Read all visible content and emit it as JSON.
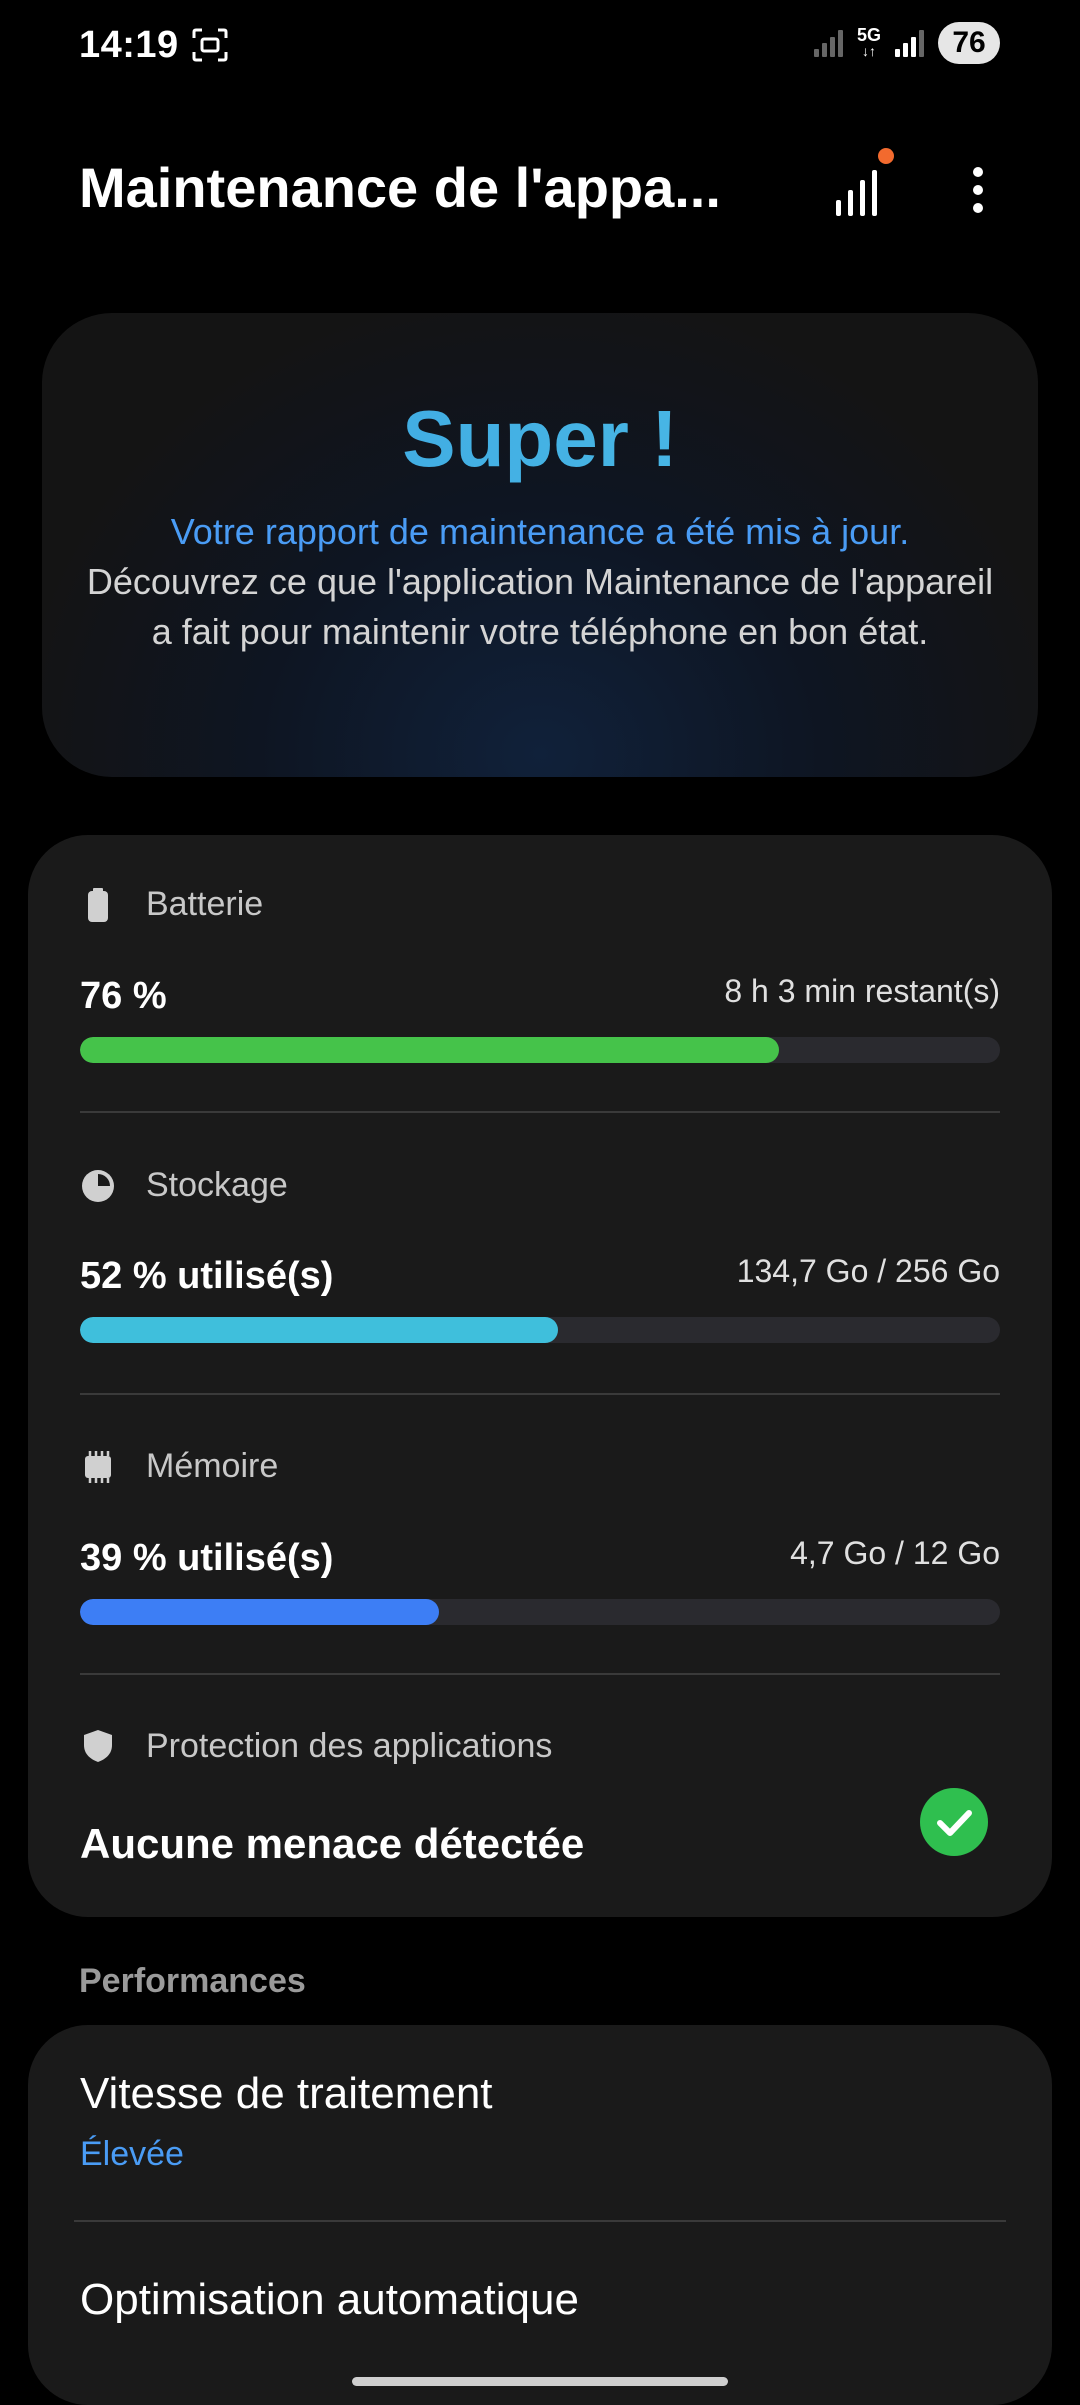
{
  "status_bar": {
    "time": "14:19",
    "network_label": "5G",
    "network_arrows": "↓↑",
    "battery": "76"
  },
  "header": {
    "title": "Maintenance de l'appa...",
    "icons": [
      "signal-chart-icon",
      "more-options-icon"
    ],
    "notification_color": "#f26a2e"
  },
  "hero": {
    "title": "Super !",
    "subtitle": "Votre rapport de maintenance a été mis à jour.",
    "body": "Découvrez ce que l'application Maintenance de l'appareil a fait pour maintenir votre téléphone en bon état."
  },
  "battery": {
    "label": "Batterie",
    "value": "76 %",
    "detail": "8 h 3 min restant(s)",
    "percent": 76,
    "color": "#45c34a"
  },
  "storage": {
    "label": "Stockage",
    "value": "52 % utilisé(s)",
    "detail": "134,7 Go / 256 Go",
    "percent": 52,
    "color": "#3fbfdc"
  },
  "memory": {
    "label": "Mémoire",
    "value": "39 % utilisé(s)",
    "detail": "4,7 Go / 12 Go",
    "percent": 39,
    "color": "#3d7ef5"
  },
  "protection": {
    "label": "Protection des applications",
    "status": "Aucune menace détectée"
  },
  "performances": {
    "section_title": "Performances",
    "items": [
      {
        "label": "Vitesse de traitement",
        "value": "Élevée"
      },
      {
        "label": "Optimisation automatique"
      }
    ]
  },
  "colors": {
    "accent_blue": "#4a9cf5",
    "check_green": "#2fbf4f"
  }
}
